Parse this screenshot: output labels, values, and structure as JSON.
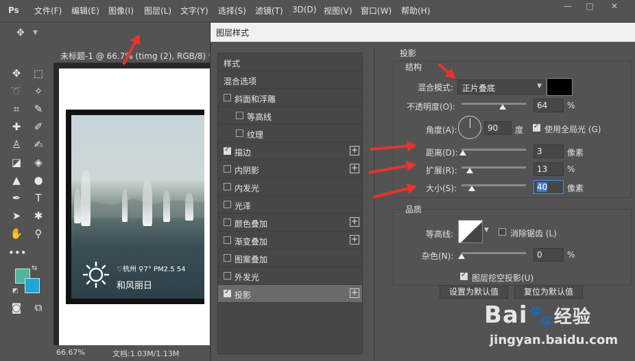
{
  "menubar": {
    "items": [
      "文件(F)",
      "编辑(E)",
      "图像(I)",
      "图层(L)",
      "文字(Y)",
      "选择(S)",
      "滤镜(T)",
      "3D(D)",
      "视图(V)",
      "窗口(W)",
      "帮助(H)"
    ],
    "logo": "Ps"
  },
  "window_controls": {
    "minimize": "—",
    "maximize": "□",
    "close": "✕"
  },
  "options_bar": {
    "collapse_glyph": "«"
  },
  "document": {
    "tab_title": "未标题-1 @ 66.7% (timg (2), RGB/8) *",
    "zoom": "66.67%",
    "doc_size": "文档:1.03M/1.13M",
    "weather_line1": "♡杭州 ⚲7° PM2.5 54",
    "weather_line2": "和风丽日"
  },
  "dialog": {
    "title": "图层样式",
    "styles_header": "样式",
    "blend_options": "混合选项",
    "effects": [
      {
        "label": "斜面和浮雕",
        "checked": false,
        "plus": false,
        "indent": 0
      },
      {
        "label": "等高线",
        "checked": false,
        "plus": false,
        "indent": 1
      },
      {
        "label": "纹理",
        "checked": false,
        "plus": false,
        "indent": 1
      },
      {
        "label": "描边",
        "checked": true,
        "plus": true,
        "indent": 0
      },
      {
        "label": "内阴影",
        "checked": false,
        "plus": true,
        "indent": 0
      },
      {
        "label": "内发光",
        "checked": false,
        "plus": false,
        "indent": 0
      },
      {
        "label": "光泽",
        "checked": false,
        "plus": false,
        "indent": 0
      },
      {
        "label": "颜色叠加",
        "checked": false,
        "plus": true,
        "indent": 0
      },
      {
        "label": "渐变叠加",
        "checked": false,
        "plus": true,
        "indent": 0
      },
      {
        "label": "图案叠加",
        "checked": false,
        "plus": false,
        "indent": 0
      },
      {
        "label": "外发光",
        "checked": false,
        "plus": false,
        "indent": 0
      },
      {
        "label": "投影",
        "checked": true,
        "plus": true,
        "indent": 0,
        "selected": true
      }
    ],
    "panel_title": "投影",
    "structure": {
      "title": "结构",
      "blend_mode_label": "混合模式:",
      "blend_mode_value": "正片叠底",
      "shadow_color": "#000000",
      "opacity_label": "不透明度(O):",
      "opacity_value": "64",
      "opacity_unit": "%",
      "opacity_fraction": 0.64,
      "angle_label": "角度(A):",
      "angle_value": "90",
      "angle_unit": "度",
      "global_light_label": "使用全局光 (G)",
      "global_light_checked": true,
      "distance_label": "距离(D):",
      "distance_value": "3",
      "distance_unit": "像素",
      "distance_fraction": 0.02,
      "spread_label": "扩展(R):",
      "spread_value": "13",
      "spread_unit": "%",
      "spread_fraction": 0.13,
      "size_label": "大小(S):",
      "size_value": "40",
      "size_unit": "像素",
      "size_fraction": 0.16
    },
    "quality": {
      "title": "品质",
      "contour_label": "等高线:",
      "antialias_label": "消除锯齿 (L)",
      "antialias_checked": false,
      "noise_label": "杂色(N):",
      "noise_value": "0",
      "noise_unit": "%",
      "noise_fraction": 0.0
    },
    "knockout_label": "图层挖空投影(U)",
    "knockout_checked": true,
    "set_default_button": "设置为默认值",
    "reset_default_button": "复位为默认值"
  },
  "watermark": {
    "brand": "Bai",
    "brand_tail": "经验",
    "url": "jingyan.baidu.com"
  },
  "colors": {
    "foreground": "#4bb5a0",
    "background": "#1ea8d8",
    "annotation_arrow": "#e8342c"
  }
}
